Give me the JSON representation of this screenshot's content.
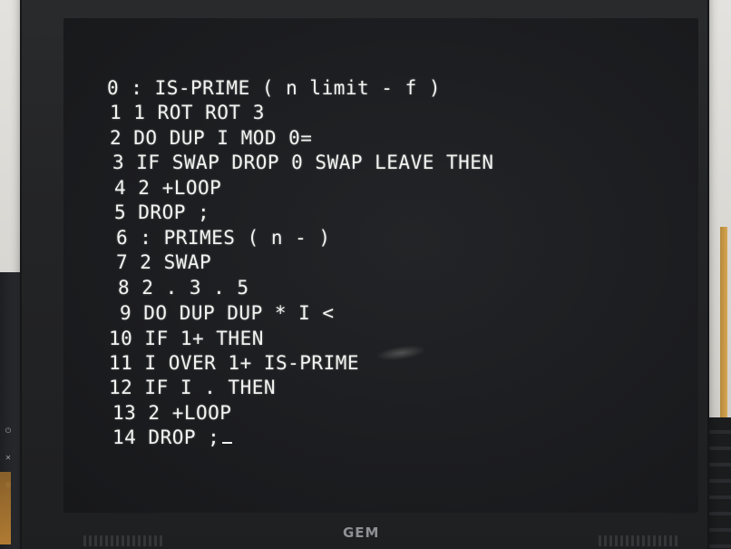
{
  "screen": {
    "lines": [
      "0 : IS-PRIME ( n limit - f )",
      "1 1 ROT ROT 3",
      "2 DO DUP I MOD 0=",
      "3 IF SWAP DROP 0 SWAP LEAVE THEN",
      "4 2 +LOOP",
      "5 DROP ;",
      "6 : PRIMES ( n - )",
      "7 2 SWAP",
      "8 2 . 3 . 5",
      "9 DO DUP DUP * I <",
      "10 IF 1+ THEN",
      "11 I OVER 1+ IS-PRIME",
      "12 IF I . THEN",
      "13 2 +LOOP",
      "14 DROP ;"
    ]
  },
  "monitor": {
    "brand": "GEM"
  },
  "colors": {
    "screen_text": "#f2f2f0",
    "screen_bg": "#1c1d20",
    "bezel": "#232426"
  }
}
